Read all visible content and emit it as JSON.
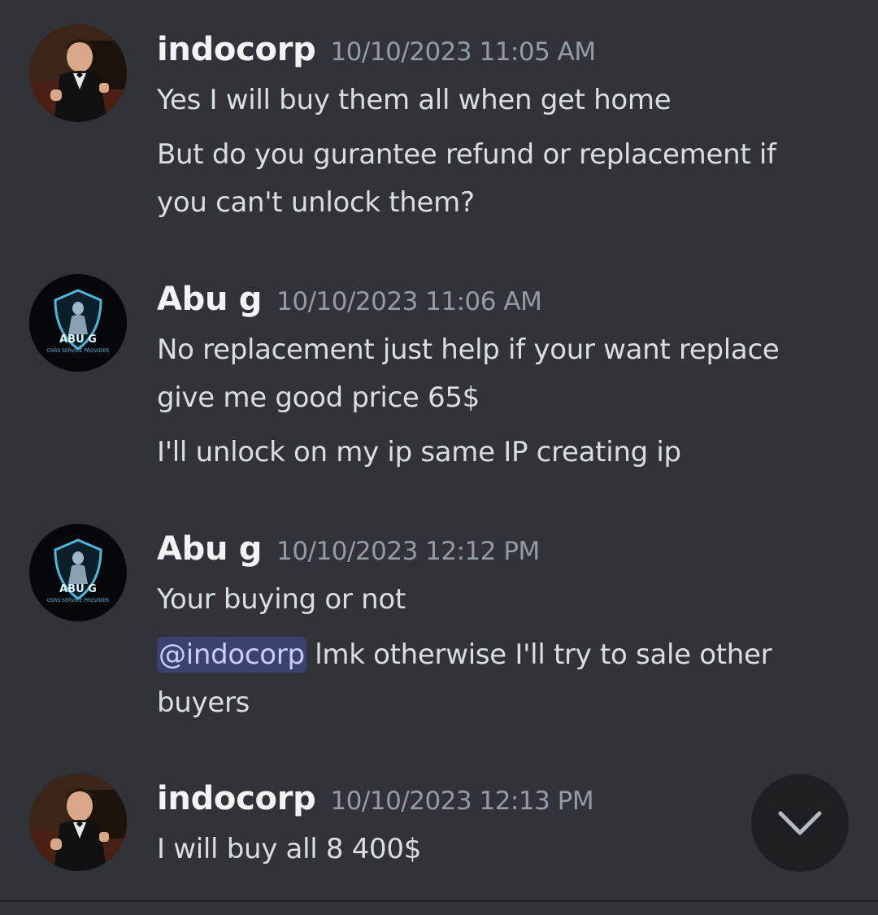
{
  "messages": [
    {
      "username": "indocorp",
      "timestamp": "10/10/2023 11:05 AM",
      "lines": [
        "Yes I will buy them all when get home",
        "But do you gurantee refund or replacement if",
        "you can't unlock them?"
      ]
    },
    {
      "username": "Abu g",
      "timestamp": "10/10/2023 11:06 AM",
      "lines": [
        "No replacement just help if your want replace",
        "give me good price 65$",
        "I'll unlock on my ip same IP creating ip"
      ]
    },
    {
      "username": "Abu g",
      "timestamp": "10/10/2023 12:12 PM",
      "lines": [
        "Your buying or not",
        "lmk otherwise I'll try to sale other",
        "buyers"
      ],
      "mention": "@indocorp"
    },
    {
      "username": "indocorp",
      "timestamp": "10/10/2023 12:13 PM",
      "lines": [
        "I will buy all 8 400$"
      ]
    }
  ],
  "avatars": {
    "abu_g_logo_text": "ABU G",
    "abu_g_logo_subtext": "OSRS SERVICE PROVIDER"
  },
  "icons": {
    "scroll": "chevron-down-icon"
  },
  "colors": {
    "background": "#313338",
    "mention_bg": "#3c4270",
    "mention_text": "#c9cdfb",
    "timestamp": "#949ba4"
  }
}
